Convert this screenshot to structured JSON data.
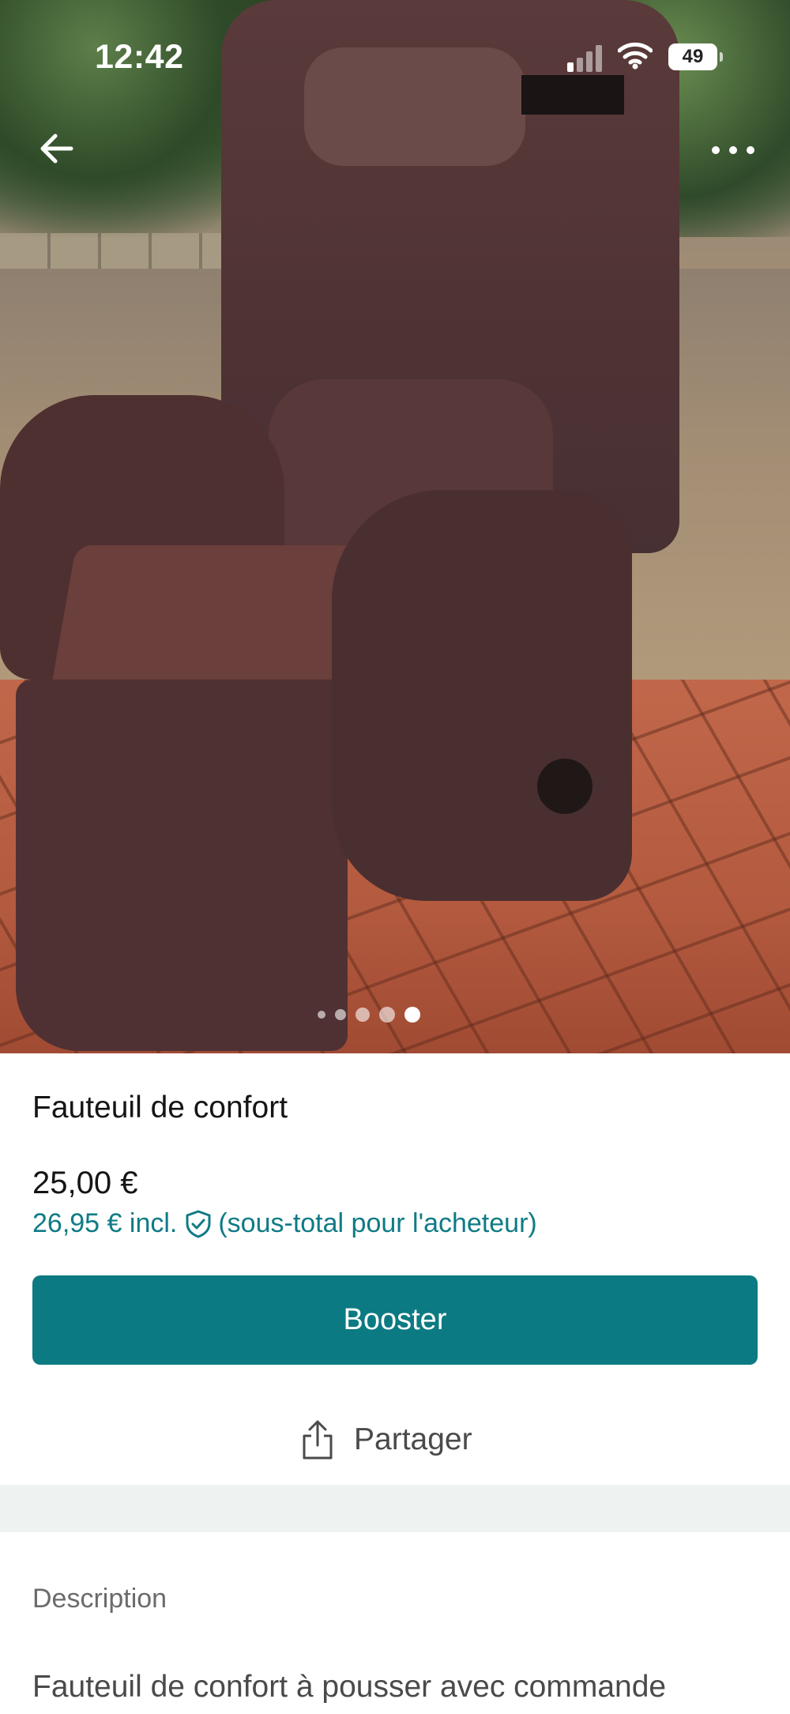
{
  "status_bar": {
    "time": "12:42",
    "battery": "49"
  },
  "photo": {
    "alt_subject": "fauteuil de confort",
    "gallery_count": 5,
    "gallery_active_index": 5
  },
  "item": {
    "title": "Fauteuil de confort",
    "price": "25,00 €",
    "buyer_price": "26,95 € incl.",
    "buyer_note": "(sous-total pour l'acheteur)"
  },
  "actions": {
    "boost_label": "Booster",
    "share_label": "Partager"
  },
  "description": {
    "label": "Description",
    "text": "Fauteuil de confort à pousser avec commande"
  },
  "colors": {
    "accent": "#0c7a82",
    "buyer_price": "#0f7b85",
    "divider": "#eef2f1"
  },
  "icons": [
    "back-arrow-icon",
    "more-options-icon",
    "signal-icon",
    "wifi-icon",
    "battery-icon",
    "shield-check-icon",
    "share-icon"
  ]
}
